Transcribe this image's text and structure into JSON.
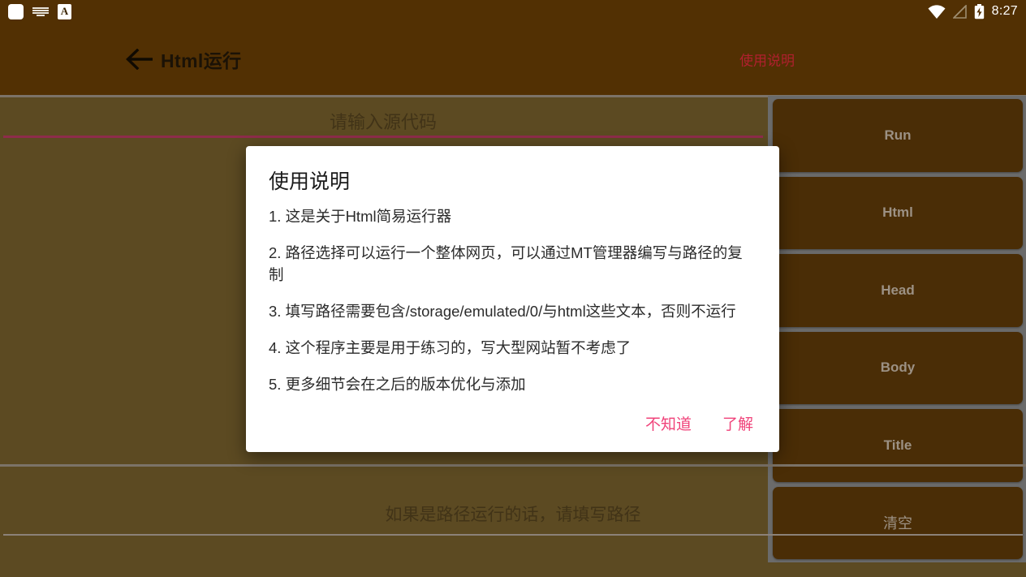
{
  "status_bar": {
    "icons_left": [
      "app-square-icon",
      "keyboard-icon",
      "letter-a-icon"
    ],
    "letter_icon_text": "A",
    "icons_right": [
      "wifi-icon",
      "signal-off-icon",
      "battery-charging-icon"
    ],
    "time": "8:27"
  },
  "title_bar": {
    "back_icon": "back-arrow-icon",
    "title": "Html运行",
    "help_link": "使用说明",
    "help_color": "#b0202e"
  },
  "editor": {
    "source_placeholder": "请输入源代码",
    "source_value": "",
    "underline_color": "#8e2c4b",
    "path_placeholder": "如果是路径运行的话，请填写路径",
    "path_value": ""
  },
  "side_buttons": [
    {
      "label": "Run",
      "cn": false
    },
    {
      "label": "Html",
      "cn": false
    },
    {
      "label": "Head",
      "cn": false
    },
    {
      "label": "Body",
      "cn": false
    },
    {
      "label": "Title",
      "cn": false
    },
    {
      "label": "清空",
      "cn": true
    }
  ],
  "dialog": {
    "title": "使用说明",
    "lines": [
      "1. 这是关于Html简易运行器",
      " 2. 路径选择可以运行一个整体网页，可以通过MT管理器编写与路径的复制",
      "3. 填写路径需要包含/storage/emulated/0/与html这些文本，否则不运行",
      "4. 这个程序主要是用于练习的，写大型网站暂不考虑了",
      "5. 更多细节会在之后的版本优化与添加"
    ],
    "negative_button": "不知道",
    "positive_button": "了解",
    "button_color": "#f0437a"
  },
  "theme": {
    "top_bar_bg": "#523003",
    "content_bg": "#5c4a22",
    "button_bg": "#4a2d06",
    "button_text": "#9c9184",
    "divider": "#7c7368"
  }
}
